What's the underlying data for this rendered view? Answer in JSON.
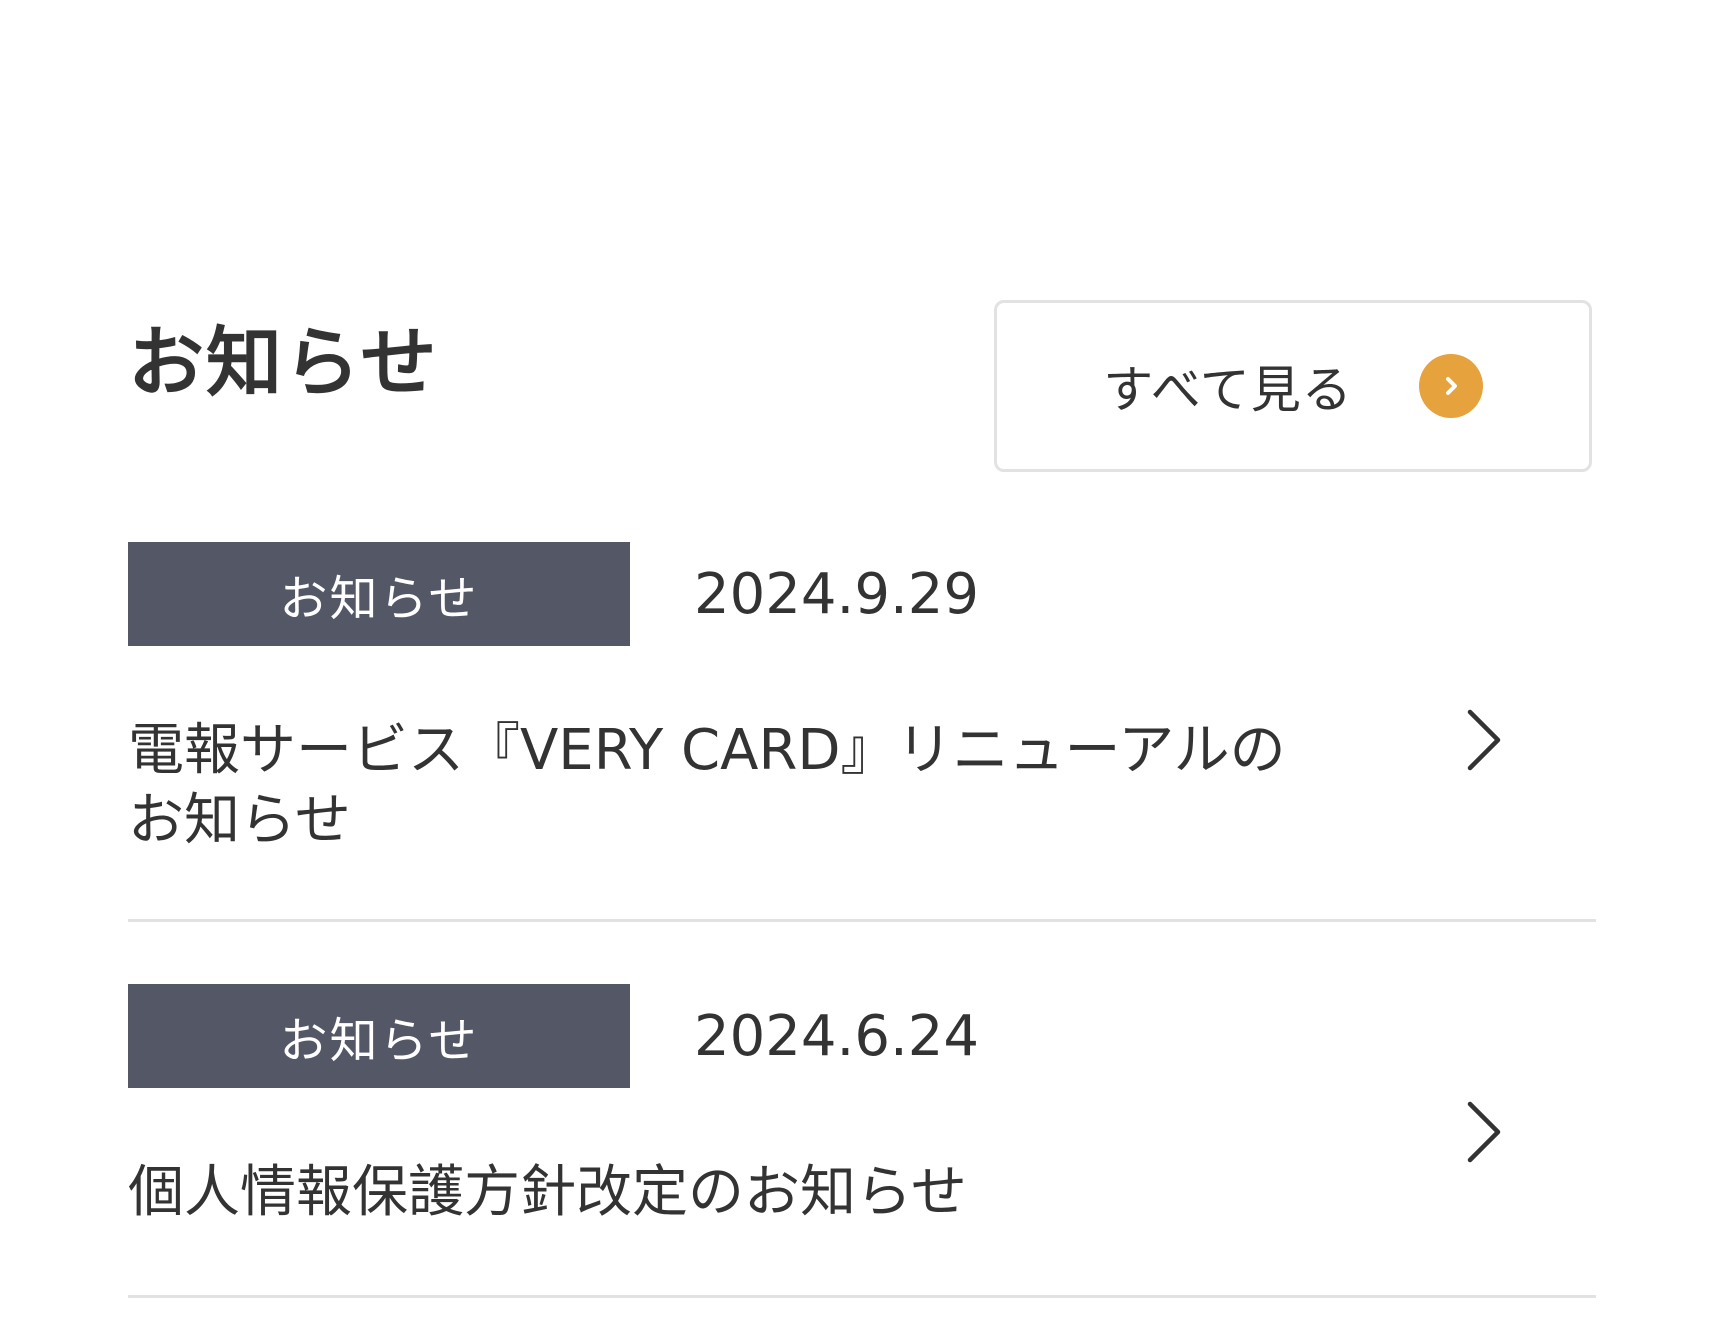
{
  "section": {
    "title": "お知らせ",
    "view_all_label": "すべて見る",
    "view_all_icon": "chevron-right-circle-icon",
    "accent_color": "#e6a23c"
  },
  "news": [
    {
      "category": "お知らせ",
      "date": "2024.9.29",
      "title_line1": "電報サービス『VERY CARD』リニューアルの",
      "title_line2": "お知らせ"
    },
    {
      "category": "お知らせ",
      "date": "2024.6.24",
      "title_line1": "個人情報保護方針改定のお知らせ"
    }
  ],
  "colors": {
    "category_bg": "#545766",
    "divider": "#e2e2e2",
    "text": "#333333"
  }
}
